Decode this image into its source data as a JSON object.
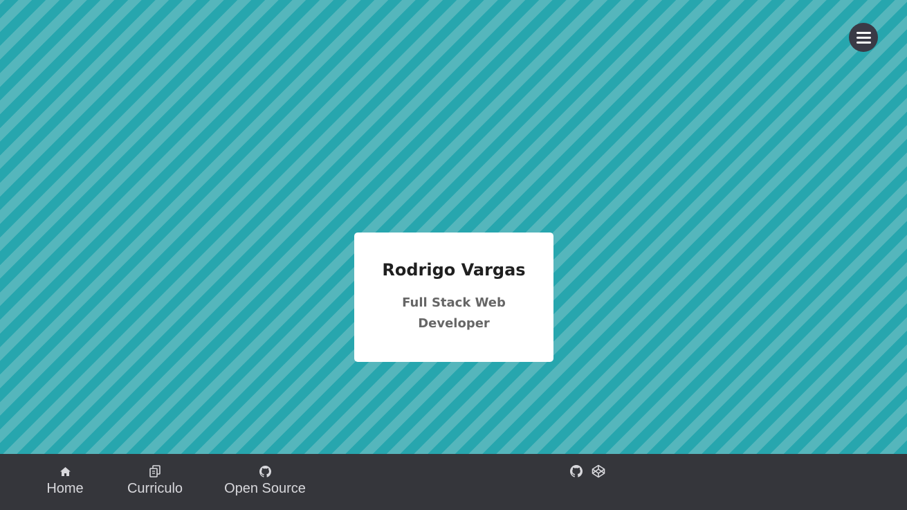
{
  "card": {
    "name": "Rodrigo Vargas",
    "role": "Full Stack Web Developer"
  },
  "menu": {
    "icon": "hamburger-icon"
  },
  "footer": {
    "nav": [
      {
        "label": "Home",
        "icon": "home-icon"
      },
      {
        "label": "Curriculo",
        "icon": "documents-icon"
      },
      {
        "label": "Open Source",
        "icon": "github-icon"
      }
    ],
    "social": [
      {
        "icon": "github-icon"
      },
      {
        "icon": "codepen-icon"
      }
    ]
  },
  "colors": {
    "stripe_dark": "#27a6ae",
    "stripe_light": "#55b6bc",
    "footer_bg": "#35363b",
    "menu_bg": "#3a3a46",
    "card_bg": "#ffffff"
  }
}
